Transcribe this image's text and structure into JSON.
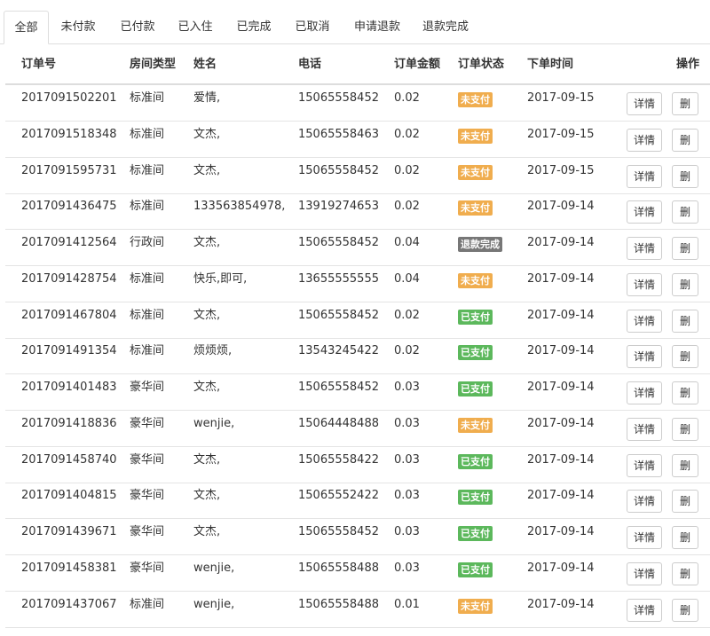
{
  "tabs": [
    {
      "label": "全部",
      "active": true
    },
    {
      "label": "未付款",
      "active": false
    },
    {
      "label": "已付款",
      "active": false
    },
    {
      "label": "已入住",
      "active": false
    },
    {
      "label": "已完成",
      "active": false
    },
    {
      "label": "已取消",
      "active": false
    },
    {
      "label": "申请退款",
      "active": false
    },
    {
      "label": "退款完成",
      "active": false
    }
  ],
  "table": {
    "headers": {
      "order_no": "订单号",
      "room_type": "房间类型",
      "name": "姓名",
      "phone": "电话",
      "amount": "订单金额",
      "status": "订单状态",
      "time": "下单时间",
      "actions": "操作"
    },
    "buttons": {
      "detail": "详情",
      "delete": "删"
    },
    "status_colors": {
      "未支付": "#f0ad4e",
      "已支付": "#5cb85c",
      "退款完成": "#777777"
    },
    "rows": [
      {
        "order_no": "2017091502201",
        "room_type": "标准间",
        "name": "爱情,",
        "phone": "15065558452",
        "amount": "0.02",
        "status": "未支付",
        "time": "2017-09-15"
      },
      {
        "order_no": "2017091518348",
        "room_type": "标准间",
        "name": "文杰,",
        "phone": "15065558463",
        "amount": "0.02",
        "status": "未支付",
        "time": "2017-09-15"
      },
      {
        "order_no": "2017091595731",
        "room_type": "标准间",
        "name": "文杰,",
        "phone": "15065558452",
        "amount": "0.02",
        "status": "未支付",
        "time": "2017-09-15"
      },
      {
        "order_no": "2017091436475",
        "room_type": "标准间",
        "name": "133563854978,",
        "phone": "13919274653",
        "amount": "0.02",
        "status": "未支付",
        "time": "2017-09-14"
      },
      {
        "order_no": "2017091412564",
        "room_type": "行政间",
        "name": "文杰,",
        "phone": "15065558452",
        "amount": "0.04",
        "status": "退款完成",
        "time": "2017-09-14"
      },
      {
        "order_no": "2017091428754",
        "room_type": "标准间",
        "name": "快乐,即可,",
        "phone": "13655555555",
        "amount": "0.04",
        "status": "未支付",
        "time": "2017-09-14"
      },
      {
        "order_no": "2017091467804",
        "room_type": "标准间",
        "name": "文杰,",
        "phone": "15065558452",
        "amount": "0.02",
        "status": "已支付",
        "time": "2017-09-14"
      },
      {
        "order_no": "2017091491354",
        "room_type": "标准间",
        "name": "烦烦烦,",
        "phone": "13543245422",
        "amount": "0.02",
        "status": "已支付",
        "time": "2017-09-14"
      },
      {
        "order_no": "2017091401483",
        "room_type": "豪华间",
        "name": "文杰,",
        "phone": "15065558452",
        "amount": "0.03",
        "status": "已支付",
        "time": "2017-09-14"
      },
      {
        "order_no": "2017091418836",
        "room_type": "豪华间",
        "name": "wenjie,",
        "phone": "15064448488",
        "amount": "0.03",
        "status": "未支付",
        "time": "2017-09-14"
      },
      {
        "order_no": "2017091458740",
        "room_type": "豪华间",
        "name": "文杰,",
        "phone": "15065558422",
        "amount": "0.03",
        "status": "已支付",
        "time": "2017-09-14"
      },
      {
        "order_no": "2017091404815",
        "room_type": "豪华间",
        "name": "文杰,",
        "phone": "15065552422",
        "amount": "0.03",
        "status": "已支付",
        "time": "2017-09-14"
      },
      {
        "order_no": "2017091439671",
        "room_type": "豪华间",
        "name": "文杰,",
        "phone": "15065558452",
        "amount": "0.03",
        "status": "已支付",
        "time": "2017-09-14"
      },
      {
        "order_no": "2017091458381",
        "room_type": "豪华间",
        "name": "wenjie,",
        "phone": "15065558488",
        "amount": "0.03",
        "status": "已支付",
        "time": "2017-09-14"
      },
      {
        "order_no": "2017091437067",
        "room_type": "标准间",
        "name": "wenjie,",
        "phone": "15065558488",
        "amount": "0.01",
        "status": "未支付",
        "time": "2017-09-14"
      }
    ]
  }
}
